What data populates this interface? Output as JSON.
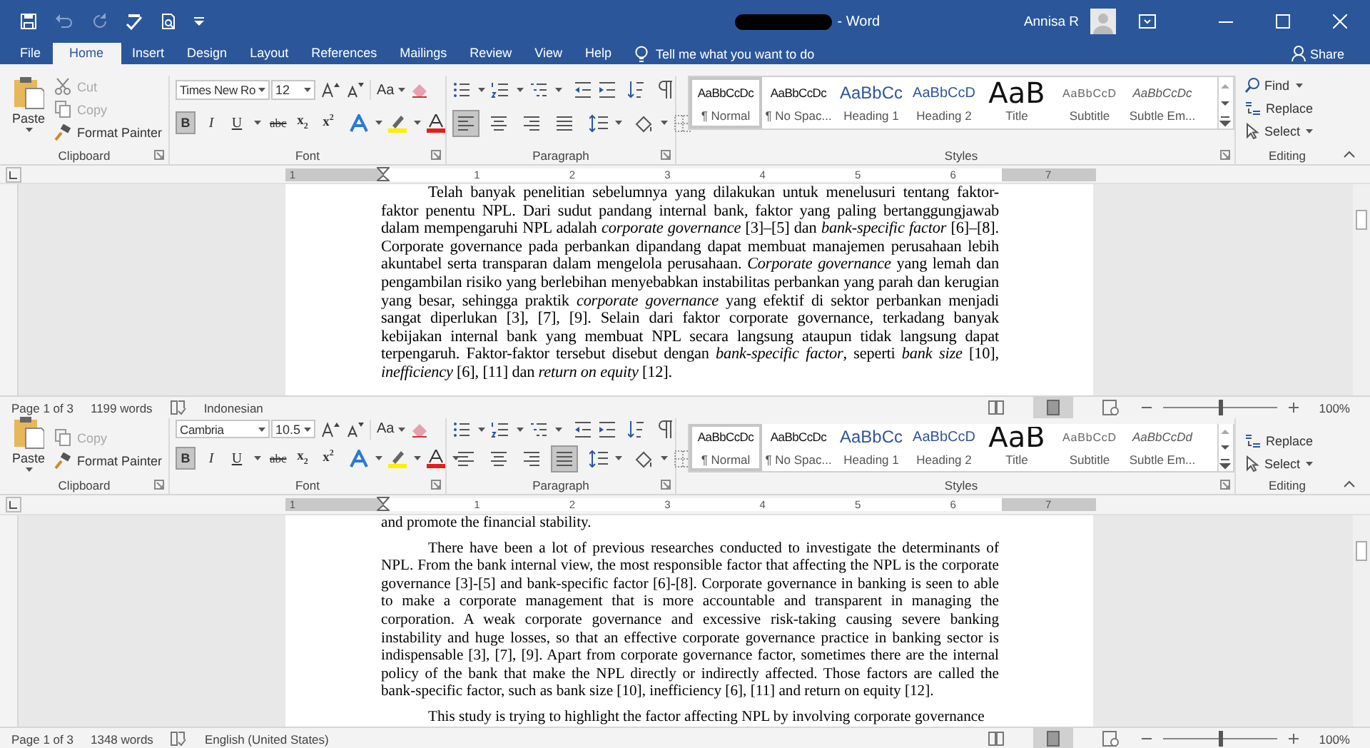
{
  "title_bar": {
    "title": "- Word",
    "user": "Annisa R"
  },
  "tabs": [
    {
      "label": "File",
      "selected": false
    },
    {
      "label": "Home",
      "selected": true
    },
    {
      "label": "Insert",
      "selected": false
    },
    {
      "label": "Design",
      "selected": false
    },
    {
      "label": "Layout",
      "selected": false
    },
    {
      "label": "References",
      "selected": false
    },
    {
      "label": "Mailings",
      "selected": false
    },
    {
      "label": "Review",
      "selected": false
    },
    {
      "label": "View",
      "selected": false
    },
    {
      "label": "Help",
      "selected": false
    }
  ],
  "tell_me": "Tell me what you want to do",
  "share": "Share",
  "windows": [
    {
      "ribbon": {
        "clipboard": {
          "paste": "Paste",
          "cut": {
            "label": "Cut",
            "disabled": true
          },
          "copy": {
            "label": "Copy",
            "disabled": true
          },
          "format_painter": "Format Painter",
          "label": "Clipboard"
        },
        "font": {
          "name": "Times New Ro",
          "size": "12",
          "change_case": "Aa",
          "buttons": [
            {
              "kind": "bold",
              "label": "B",
              "selected": true
            },
            {
              "kind": "italic",
              "label": "I",
              "selected": false
            },
            {
              "kind": "underline",
              "label": "U",
              "selected": false
            },
            {
              "kind": "strike",
              "label": "abc",
              "selected": false
            },
            {
              "kind": "sub",
              "label": "x$_{2}$",
              "selected": false
            },
            {
              "kind": "sup",
              "label": "x$^{2}$",
              "selected": false
            }
          ],
          "label": "Font"
        },
        "paragraph": {
          "alignments": [
            {
              "kind": "left",
              "selected": true
            },
            {
              "kind": "center",
              "selected": false
            },
            {
              "kind": "right",
              "selected": false
            },
            {
              "kind": "justify",
              "selected": false
            }
          ],
          "label": "Paragraph"
        },
        "styles": {
          "items": [
            {
              "kind": "normal",
              "preview": "AaBbCcDc",
              "name": "¶ Normal",
              "selected": true
            },
            {
              "kind": "nospace",
              "preview": "AaBbCcDc",
              "name": "¶ No Spac...",
              "selected": false
            },
            {
              "kind": "heading1",
              "preview": "AaBbCc",
              "name": "Heading 1",
              "selected": false
            },
            {
              "kind": "heading2",
              "preview": "AaBbCcD",
              "name": "Heading 2",
              "selected": false
            },
            {
              "kind": "title",
              "preview": "AaB",
              "name": "Title",
              "selected": false
            },
            {
              "kind": "subtitle",
              "preview": "AaBbCcD",
              "name": "Subtitle",
              "selected": false
            },
            {
              "kind": "emphasis",
              "preview": "AaBbCcDc",
              "name": "Subtle Em...",
              "selected": false
            }
          ],
          "label": "Styles"
        },
        "editing": {
          "find": "Find",
          "replace": "Replace",
          "select": "Select",
          "label": "Editing"
        }
      },
      "ruler": [
        "1",
        "1",
        "2",
        "3",
        "4",
        "5",
        "6",
        "7"
      ],
      "document": {
        "paragraphs": [
          {
            "indent": true,
            "text": "Telah banyak penelitian sebelumnya yang dilakukan untuk menelusuri tentang faktor-faktor penentu NPL. Dari sudut pandang internal bank, faktor yang paling bertanggungjawab dalam mempengaruhi NPL adalah *corporate governance* [3]–[5] dan *bank-specific factor* [6]–[8]. Corporate governance pada perbankan dipandang dapat membuat manajemen perusahaan lebih akuntabel serta transparan dalam mengelola perusahaan. *Corporate governance* yang lemah dan pengambilan risiko yang berlebihan menyebabkan instabilitas perbankan yang parah dan kerugian yang besar, sehingga praktik *corporate governance* yang efektif di sektor perbankan menjadi sangat diperlukan [3], [7], [9]. Selain dari faktor corporate governance, terkadang banyak kebijakan internal bank yang membuat NPL secara langsung ataupun tidak langsung dapat terpengaruh. Faktor-faktor tersebut disebut dengan *bank-specific factor*, seperti *bank size* [10], *inefficiency* [6], [11] dan *return on equity* [12]."
          }
        ]
      },
      "status_bar": {
        "page": "Page 1 of 3",
        "words": "1199 words",
        "language": "Indonesian",
        "zoom": {
          "level": 0.5,
          "label": "100%"
        }
      }
    },
    {
      "ribbon": {
        "clipboard": {
          "paste": "Paste",
          "copy": {
            "label": "Copy",
            "disabled": true
          },
          "format_painter": "Format Painter",
          "label": "Clipboard"
        },
        "font": {
          "name": "Cambria",
          "size": "10.5",
          "change_case": "Aa",
          "buttons": [
            {
              "kind": "bold",
              "label": "B",
              "selected": true
            },
            {
              "kind": "italic",
              "label": "I",
              "selected": false
            },
            {
              "kind": "underline",
              "label": "U",
              "selected": false
            },
            {
              "kind": "strike",
              "label": "abc",
              "selected": false
            },
            {
              "kind": "sub",
              "label": "x$_{2}$",
              "selected": false
            },
            {
              "kind": "sup",
              "label": "x$^{2}$",
              "selected": false
            }
          ],
          "label": "Font"
        },
        "paragraph": {
          "alignments": [
            {
              "kind": "left",
              "selected": false
            },
            {
              "kind": "center",
              "selected": false
            },
            {
              "kind": "right",
              "selected": false
            },
            {
              "kind": "justify",
              "selected": true
            }
          ],
          "label": "Paragraph"
        },
        "styles": {
          "items": [
            {
              "kind": "normal",
              "preview": "AaBbCcDc",
              "name": "¶ Normal",
              "selected": true
            },
            {
              "kind": "nospace",
              "preview": "AaBbCcDc",
              "name": "¶ No Spac...",
              "selected": false
            },
            {
              "kind": "heading1",
              "preview": "AaBbCc",
              "name": "Heading 1",
              "selected": false
            },
            {
              "kind": "heading2",
              "preview": "AaBbCcD",
              "name": "Heading 2",
              "selected": false
            },
            {
              "kind": "title",
              "preview": "AaB",
              "name": "Title",
              "selected": false
            },
            {
              "kind": "subtitle",
              "preview": "AaBbCcD",
              "name": "Subtitle",
              "selected": false
            },
            {
              "kind": "emphasis",
              "preview": "AaBbCcDd",
              "name": "Subtle Em...",
              "selected": false
            }
          ],
          "label": "Styles"
        },
        "editing": {
          "replace": "Replace",
          "select": "Select",
          "label": "Editing"
        }
      },
      "ruler": [
        "1",
        "1",
        "2",
        "3",
        "4",
        "5",
        "6",
        "7"
      ],
      "document": {
        "paragraphs": [
          {
            "indent": false,
            "text": "and promote the financial stability."
          },
          {
            "indent": true,
            "text": "There have been a lot of previous researches conducted to investigate the determinants of NPL. From the bank internal view, the most responsible factor that affecting the NPL is the corporate governance [3]-[5] and bank-specific factor [6]-[8]. Corporate governance in banking is seen to able to make a corporate management that is more accountable and transparent in managing the corporation. A weak corporate governance and excessive risk-taking causing severe banking instability and huge losses, so that an effective corporate governance practice in banking sector is indispensable [3], [7], [9]. Apart from corporate governance factor, sometimes there are the internal policy of the bank that make the NPL directly or indirectly affected. Those factors are called the bank-specific factor, such as bank size [10], inefficiency [6], [11] and return on equity [12]."
          },
          {
            "indent": true,
            "text": "This study is trying to highlight the factor affecting NPL by involving corporate governance"
          }
        ]
      },
      "status_bar": {
        "page": "Page 1 of 3",
        "words": "1348 words",
        "language": "English (United States)",
        "zoom": {
          "level": 0.5,
          "label": "100%"
        }
      }
    }
  ]
}
